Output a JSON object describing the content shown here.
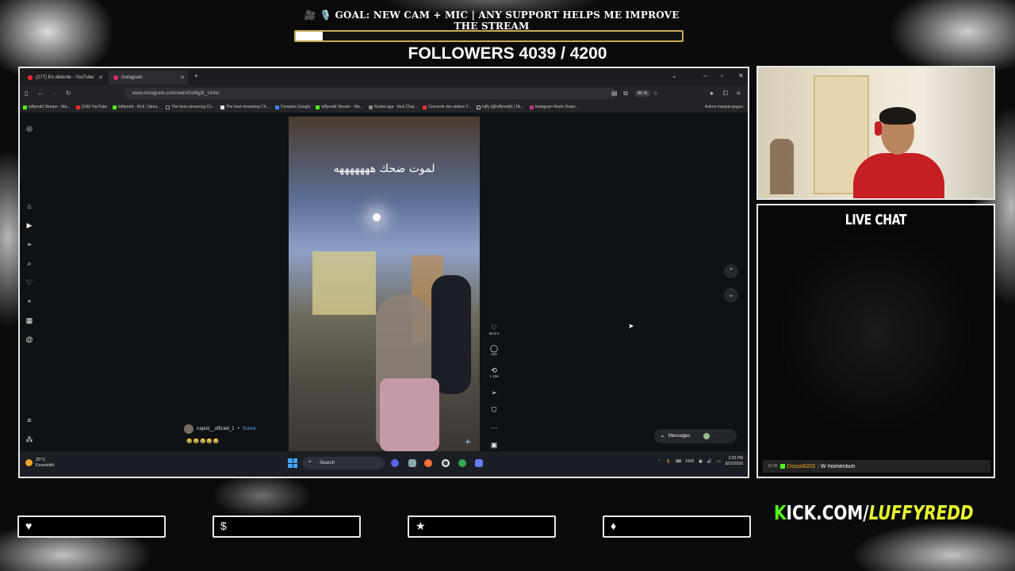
{
  "overlay": {
    "goal_text": "🎥 🎙️ GOAL: NEW CAM + MIC | ANY SUPPORT HELPS ME IMPROVE THE STREAM",
    "goal_progress": 0.07,
    "followers_text": "FOLLOWERS 4039 / 4200",
    "chat_title": "LIVE CHAT",
    "kick_prefix": "KICK.COM/",
    "kick_name": "LUFFYREDD",
    "social_icons": [
      "heart-icon",
      "dollar-icon",
      "star-icon",
      "diamond-icon"
    ],
    "colors": {
      "kick_green": "#53fc18",
      "goal_border": "#c9a95b",
      "jersey_red": "#c51f23"
    }
  },
  "chat": {
    "messages": [
      {
        "time": "10:35",
        "user": "Dosso8203",
        "text": ": W momentum"
      }
    ]
  },
  "browser": {
    "tabs": [
      {
        "label": "(277) En détente - YouTube",
        "active": false
      },
      {
        "label": "Instagram",
        "active": true
      }
    ],
    "url": "www.instagram.com/reels/DcMg3r_sV4x/",
    "zoom": "90 %",
    "bookmarks": [
      "luffyredd Stream - Wa...",
      "(100) YouTube",
      "luffyredd - Kick | Strea...",
      "The best streaming Ch...",
      "The best streaming Ch...",
      "Comptes Google",
      "luffyredd Stream - Wa...",
      "Kicklet.app - Kick Chat...",
      "Convertir des vidéos Y...",
      "luffy (@luffyredd) | Tik...",
      "Instagram Reels Down..."
    ],
    "bookmarks_other": "Autres marque-pages"
  },
  "reel": {
    "caption": "لموت ضحك هههههههه",
    "likes": "38,5 K",
    "comments": "434",
    "reposts": "1 168",
    "poster": "napoli__officiell_1",
    "follow": "Suivre",
    "emojis": "😂😂😂😂😂",
    "messages_label": "Messages"
  },
  "taskbar": {
    "temp": "25°C",
    "weather": "Ensoleillé",
    "search": "Search",
    "lang": "FRA",
    "time": "3:29 PM",
    "date": "8/22/2026"
  }
}
